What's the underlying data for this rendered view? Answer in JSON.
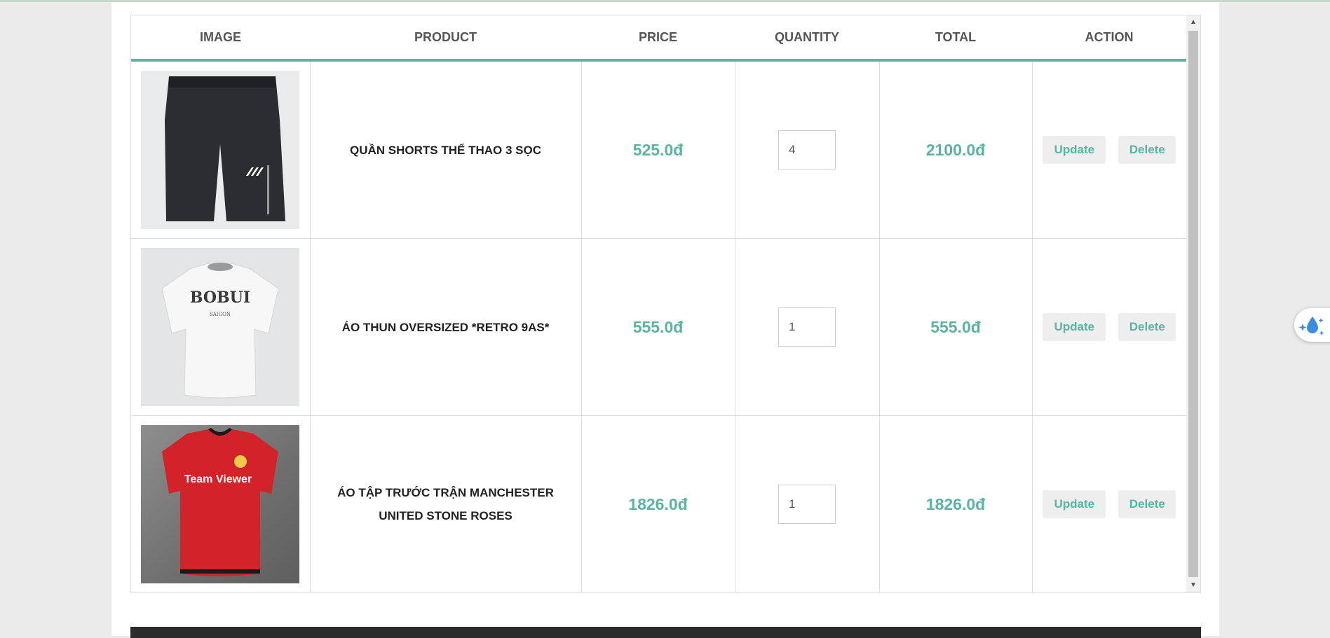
{
  "cart": {
    "headers": {
      "image": "IMAGE",
      "product": "PRODUCT",
      "price": "PRICE",
      "quantity": "QUANTITY",
      "total": "TOTAL",
      "action": "ACTION"
    },
    "items": [
      {
        "name": "QUẦN SHORTS THỂ THAO 3 SỌC",
        "image_icon": "black-shorts-image",
        "price": "525.0đ",
        "quantity": "4",
        "total": "2100.0đ",
        "update_label": "Update",
        "delete_label": "Delete"
      },
      {
        "name": "ÁO THUN OVERSIZED *RETRO 9AS*",
        "image_icon": "white-tshirt-image",
        "image_text": "BOBUI",
        "image_subtext": "SAIGON",
        "price": "555.0đ",
        "quantity": "1",
        "total": "555.0đ",
        "update_label": "Update",
        "delete_label": "Delete"
      },
      {
        "name": "ÁO TẬP TRƯỚC TRẬN MANCHESTER UNITED STONE ROSES",
        "image_icon": "red-football-jersey-image",
        "image_text": "Team Viewer",
        "price": "1826.0đ",
        "quantity": "1",
        "total": "1826.0đ",
        "update_label": "Update",
        "delete_label": "Delete"
      }
    ]
  },
  "colors": {
    "accent": "#5ab5a0",
    "header_text": "#555555",
    "button_bg": "#eeeeee",
    "footer_bg": "#2b2b2b",
    "widget_icon": "#3b8de0"
  },
  "widget": {
    "icon": "water-drop-sparkle-icon"
  }
}
